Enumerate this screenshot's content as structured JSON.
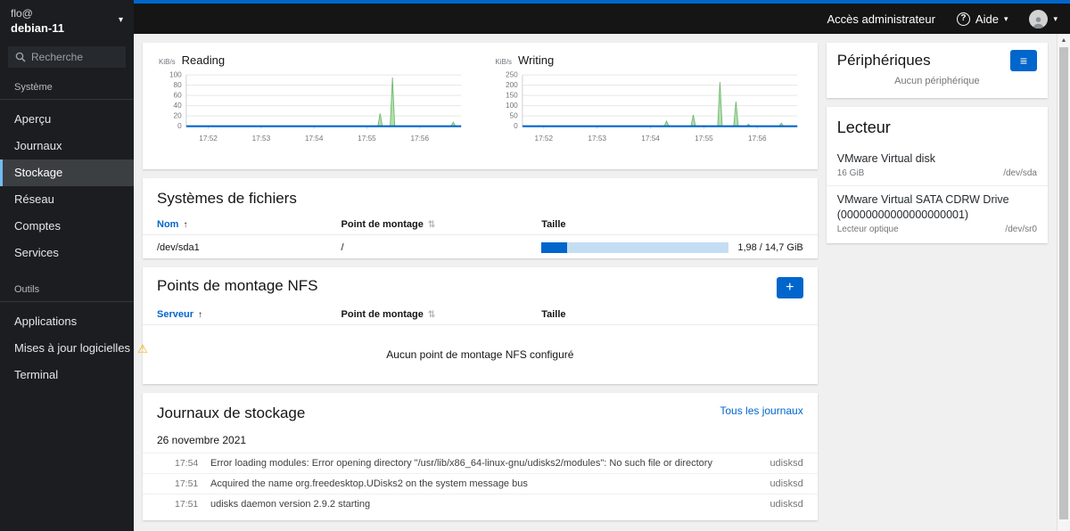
{
  "sidebar": {
    "user": "flo@",
    "host": "debian-11",
    "search_placeholder": "Recherche",
    "sections": [
      {
        "label": "Système",
        "items": [
          {
            "label": "Aperçu"
          },
          {
            "label": "Journaux"
          },
          {
            "label": "Stockage"
          },
          {
            "label": "Réseau"
          },
          {
            "label": "Comptes"
          },
          {
            "label": "Services"
          }
        ]
      },
      {
        "label": "Outils",
        "items": [
          {
            "label": "Applications"
          },
          {
            "label": "Mises à jour logicielles"
          },
          {
            "label": "Terminal"
          }
        ]
      }
    ]
  },
  "masthead": {
    "admin_access": "Accès administrateur",
    "help": "Aide"
  },
  "chart_data": [
    {
      "type": "area",
      "title": "Reading",
      "unit": "KiB/s",
      "ylim": 100,
      "yticks": [
        0,
        20,
        40,
        60,
        80,
        100
      ],
      "xticks": [
        "17:52",
        "17:53",
        "17:54",
        "17:55",
        "17:56"
      ],
      "x_domain": [
        "17:51:35",
        "17:56:47"
      ],
      "spikes": [
        {
          "t": "17:55:15",
          "v": 25
        },
        {
          "t": "17:55:29",
          "v": 95
        },
        {
          "t": "17:56:38",
          "v": 8
        }
      ],
      "baseline": 0,
      "grid": true,
      "legend": "none"
    },
    {
      "type": "area",
      "title": "Writing",
      "unit": "KiB/s",
      "ylim": 250,
      "yticks": [
        0,
        50,
        100,
        150,
        200,
        250
      ],
      "xticks": [
        "17:52",
        "17:53",
        "17:54",
        "17:55",
        "17:56"
      ],
      "x_domain": [
        "17:51:36",
        "17:56:45"
      ],
      "spikes": [
        {
          "t": "17:54:18",
          "v": 25
        },
        {
          "t": "17:54:48",
          "v": 55
        },
        {
          "t": "17:55:18",
          "v": 215
        },
        {
          "t": "17:55:36",
          "v": 120
        },
        {
          "t": "17:55:50",
          "v": 10
        },
        {
          "t": "17:56:27",
          "v": 15
        }
      ],
      "baseline": 0,
      "grid": true,
      "legend": "none"
    }
  ],
  "filesystems": {
    "title": "Systèmes de fichiers",
    "columns": [
      "Nom",
      "Point de montage",
      "Taille"
    ],
    "rows": [
      {
        "name": "/dev/sda1",
        "mount": "/",
        "used": 1.98,
        "total": 14.7,
        "size_label": "1,98 / 14,7 GiB"
      }
    ]
  },
  "nfs": {
    "title": "Points de montage NFS",
    "columns": [
      "Serveur",
      "Point de montage",
      "Taille"
    ],
    "empty": "Aucun point de montage NFS configuré"
  },
  "logs": {
    "title": "Journaux de stockage",
    "all_link": "Tous les journaux",
    "date": "26 novembre 2021",
    "entries": [
      {
        "time": "17:54",
        "message": "Error loading modules: Error opening directory \"/usr/lib/x86_64-linux-gnu/udisks2/modules\": No such file or directory",
        "service": "udisksd"
      },
      {
        "time": "17:51",
        "message": "Acquired the name org.freedesktop.UDisks2 on the system message bus",
        "service": "udisksd"
      },
      {
        "time": "17:51",
        "message": "udisks daemon version 2.9.2 starting",
        "service": "udisksd"
      }
    ]
  },
  "devices": {
    "title": "Périphériques",
    "empty": "Aucun périphérique"
  },
  "drives": {
    "title": "Lecteur",
    "items": [
      {
        "name": "VMware Virtual disk",
        "detail": "16 GiB",
        "path": "/dev/sda"
      },
      {
        "name": "VMware Virtual SATA CDRW Drive (00000000000000000001)",
        "detail": "Lecteur optique",
        "path": "/dev/sr0"
      }
    ]
  },
  "icons": {
    "caret_down": "▾",
    "warning": "⚠",
    "plus": "+",
    "help_q": "?",
    "menu": "≡",
    "sort_asc": "↑",
    "sort_both": "⇅",
    "scroll_up": "▲"
  },
  "colors": {
    "accent": "#0066cc",
    "spike_fill": "#b2deac",
    "spike_stroke": "#6ab567",
    "baseline": "#0066cc",
    "active_nav_border": "#73bcf7",
    "warning": "#f0ab00"
  }
}
